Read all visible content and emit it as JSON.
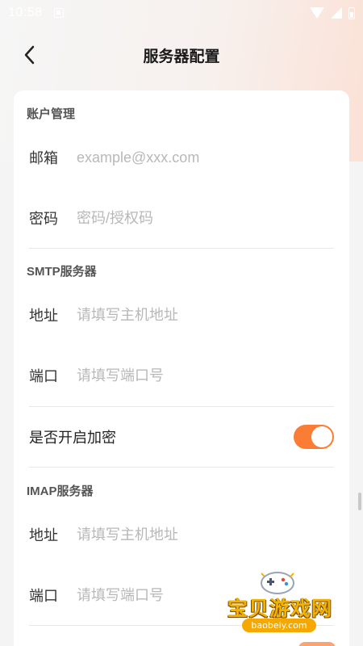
{
  "status_bar": {
    "time": "10:58"
  },
  "nav": {
    "title": "服务器配置",
    "back_icon": "chevron-left-icon"
  },
  "account": {
    "section_title": "账户管理",
    "email_label": "邮箱",
    "email_placeholder": "example@xxx.com",
    "password_label": "密码",
    "password_placeholder": "密码/授权码"
  },
  "smtp": {
    "section_title": "SMTP服务器",
    "address_label": "地址",
    "address_placeholder": "请填写主机地址",
    "port_label": "端口",
    "port_placeholder": "请填写端口号",
    "encryption_label": "是否开启加密",
    "encryption_on": true
  },
  "imap": {
    "section_title": "IMAP服务器",
    "address_label": "地址",
    "address_placeholder": "请填写主机地址",
    "port_label": "端口",
    "port_placeholder": "请填写端口号"
  },
  "colors": {
    "accent": "#fb7d35",
    "card": "#ffffff",
    "placeholder": "#b8b8b8"
  },
  "watermark": {
    "text": "宝贝游戏网",
    "url": "baobeiy.com"
  }
}
